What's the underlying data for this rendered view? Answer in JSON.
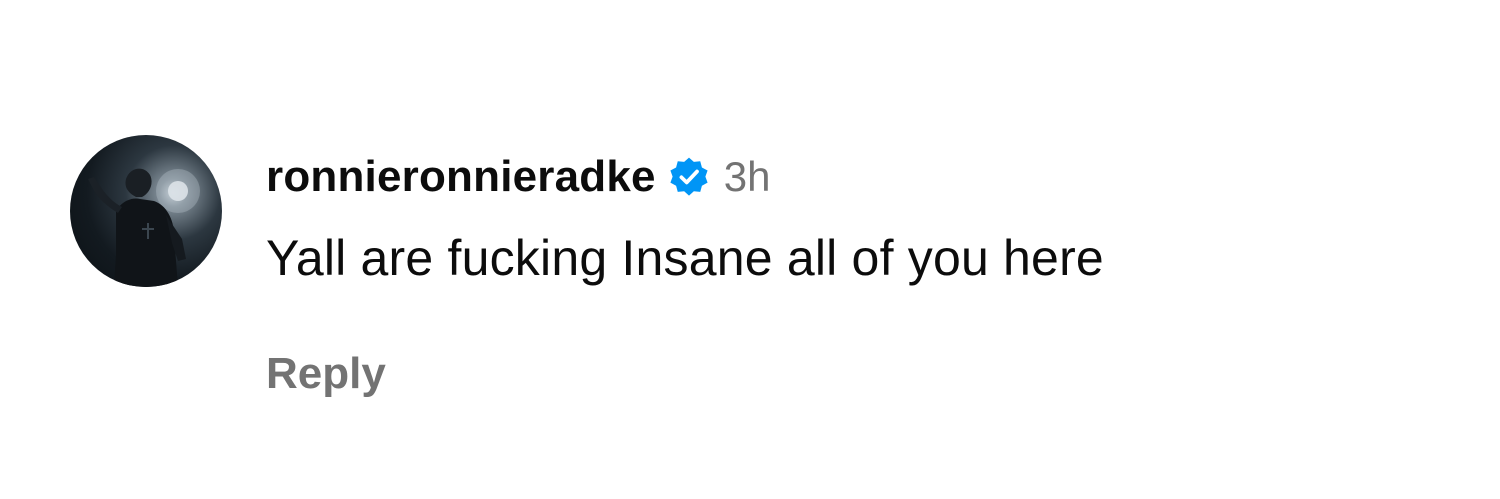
{
  "comment": {
    "username": "ronnieronnieradke",
    "verified": true,
    "verified_icon": "verified-badge-icon",
    "timestamp": "3h",
    "text": "Yall are fucking Insane all of you here",
    "reply_label": "Reply"
  },
  "colors": {
    "text_primary": "#0c0c0c",
    "text_secondary": "#737373",
    "verified_blue": "#0095f6",
    "background": "#ffffff"
  }
}
